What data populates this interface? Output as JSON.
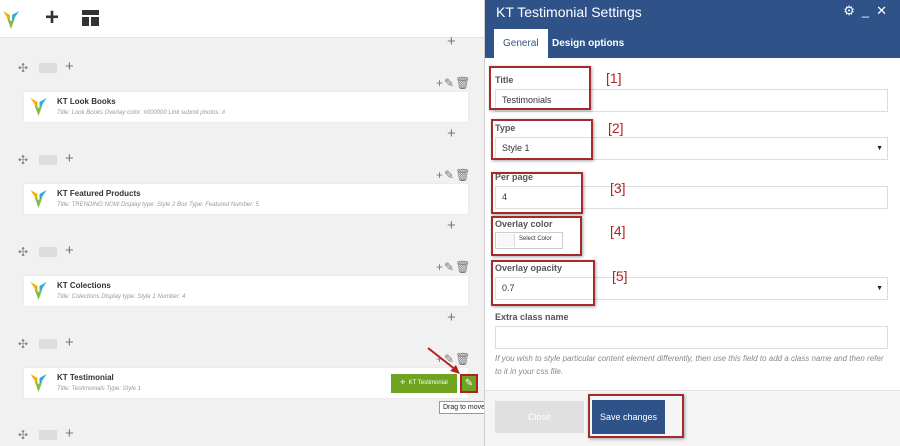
{
  "editor": {
    "topbar": {
      "add_icon": "+",
      "logo": "visual-composer-logo"
    },
    "elements": [
      {
        "title": "KT Look Books",
        "subtitle": "Title: Look Books  Overlay color: #000000  Link submit photos: #"
      },
      {
        "title": "KT Featured Products",
        "subtitle": "Title: TRENDING NOW  Display type: Style 2  Box Type: Featured  Number: 5"
      },
      {
        "title": "KT Colections",
        "subtitle": "Title: Colections  Display type: Style 1  Number: 4"
      },
      {
        "title": "KT Testimonial",
        "subtitle": "Title: Testimonials  Type: Style 1"
      }
    ],
    "drag_button_label": "KT Testimonial",
    "tooltip": "Drag to move KT Testimonial"
  },
  "panel": {
    "title": "KT Testimonial Settings",
    "tabs": [
      "General",
      "Design options"
    ],
    "fields": {
      "title_label": "Title",
      "title_value": "Testimonials",
      "type_label": "Type",
      "type_value": "Style 1",
      "per_page_label": "Per page",
      "per_page_value": "4",
      "overlay_color_label": "Overlay color",
      "select_color_label": "Select Color",
      "overlay_opacity_label": "Overlay opacity",
      "overlay_opacity_value": "0.7",
      "extra_class_label": "Extra class name",
      "extra_class_value": ""
    },
    "help_text": "If you wish to style particular content element differently, then use this field to add a class name and then refer to it in your css file.",
    "close_label": "Close",
    "save_label": "Save changes"
  },
  "annotations": [
    "[1]",
    "[2]",
    "[3]",
    "[4]",
    "[5]"
  ],
  "colors": {
    "header": "#2f5288",
    "green": "#6ea421",
    "annotation": "#b22222"
  }
}
